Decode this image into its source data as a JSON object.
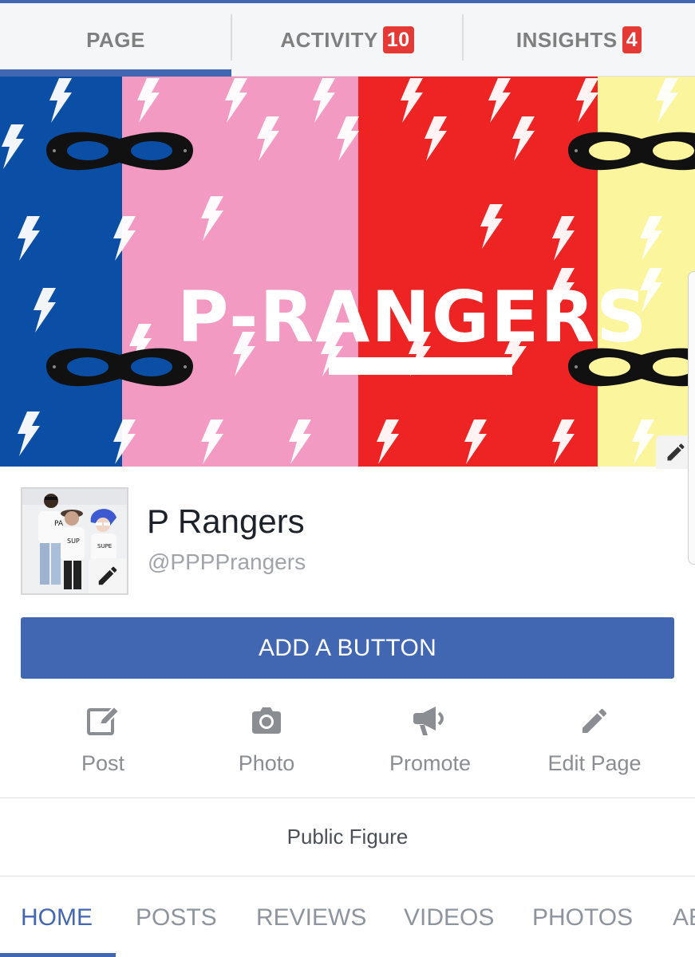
{
  "top_tabs": [
    {
      "label": "PAGE",
      "badge": null,
      "active": true
    },
    {
      "label": "ACTIVITY",
      "badge": "10",
      "active": false
    },
    {
      "label": "INSIGHTS",
      "badge": "4",
      "active": false
    }
  ],
  "cover": {
    "title": "P-RANGERS",
    "stripe_colors": [
      "#0a4ea5",
      "#f39ac3",
      "#ee2424",
      "#fbf59e"
    ],
    "edit_icon": "pencil-icon"
  },
  "profile": {
    "name": "P Rangers",
    "handle": "@PPPPrangers",
    "avatar_edit_icon": "pencil-icon"
  },
  "primary_button": {
    "label": "ADD A BUTTON",
    "color": "#4267b2"
  },
  "actions": [
    {
      "label": "Post",
      "icon": "compose-icon"
    },
    {
      "label": "Photo",
      "icon": "camera-icon"
    },
    {
      "label": "Promote",
      "icon": "megaphone-icon"
    },
    {
      "label": "Edit Page",
      "icon": "pencil-icon"
    }
  ],
  "category": "Public Figure",
  "bottom_tabs": [
    {
      "label": "HOME",
      "active": true
    },
    {
      "label": "POSTS",
      "active": false
    },
    {
      "label": "REVIEWS",
      "active": false
    },
    {
      "label": "VIDEOS",
      "active": false
    },
    {
      "label": "PHOTOS",
      "active": false
    },
    {
      "label": "AB",
      "active": false
    }
  ],
  "colors": {
    "accent": "#4267b2",
    "badge": "#e53935",
    "muted_text": "#8d949e"
  }
}
